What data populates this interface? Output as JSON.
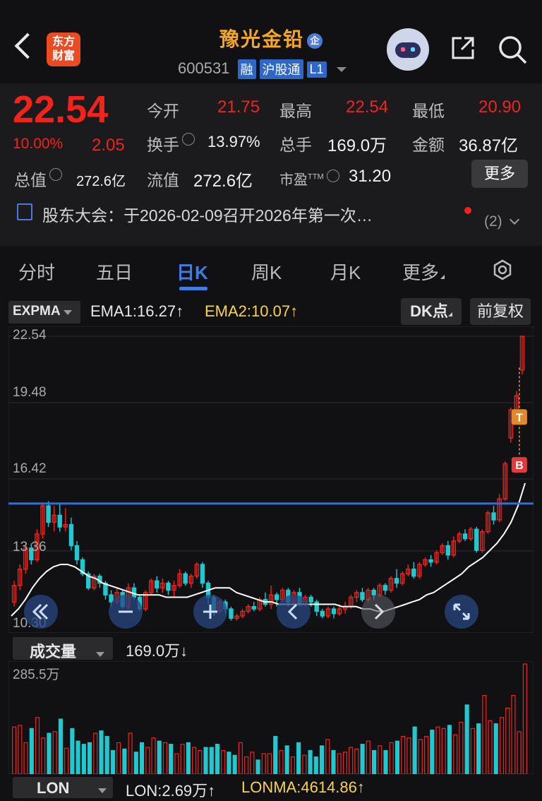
{
  "header": {
    "back_icon": "chevron-left-icon",
    "logo_text_1": "东方",
    "logo_text_2": "财富",
    "stock_name": "豫光金铅",
    "enterprise_badge": "企",
    "stock_code": "600531",
    "tags": [
      "融",
      "沪股通",
      "L1"
    ],
    "share_icon": "share-icon",
    "search_icon": "search-icon",
    "assistant_icon": "robot-icon"
  },
  "quote": {
    "price": "22.54",
    "change_pct": "10.00%",
    "change": "2.05",
    "open_label": "今开",
    "open": "21.75",
    "high_label": "最高",
    "high": "22.54",
    "low_label": "最低",
    "low": "20.90",
    "turnover_label": "换手",
    "turnover": "13.97%",
    "volume_label": "总手",
    "volume": "169.0万",
    "amount_label": "金额",
    "amount": "36.87亿",
    "mktcap_label": "总值",
    "mktcap": "272.6亿",
    "float_label": "流值",
    "float_cap": "272.6亿",
    "pe_label": "市盈",
    "pe_sup": "TTM",
    "pe": "31.20",
    "more_label": "更多"
  },
  "notice": {
    "text": "股东大会：于2026-02-09召开2026年第一次…",
    "count": "(2)"
  },
  "tabs": {
    "items": [
      "分时",
      "五日",
      "日K",
      "周K",
      "月K",
      "更多"
    ],
    "active": "日K"
  },
  "indicator": {
    "name": "EXPMA",
    "ema1": "EMA1:16.27",
    "ema2": "EMA2:10.07",
    "arrow": "↑",
    "dk_label": "DK点",
    "adjust_label": "前复权"
  },
  "chart_data": {
    "type": "candlestick",
    "y_ticks": [
      "22.54",
      "19.48",
      "16.42",
      "13.36",
      "10.30"
    ],
    "ylim": [
      10.3,
      22.54
    ],
    "reference_line": 15.4,
    "markers": [
      "T",
      "B"
    ],
    "candles": [
      [
        11.2,
        11.9,
        11.0,
        12.1
      ],
      [
        11.9,
        12.6,
        11.7,
        12.8
      ],
      [
        12.6,
        13.5,
        12.4,
        13.6
      ],
      [
        13.5,
        13.0,
        12.8,
        13.7
      ],
      [
        13.0,
        14.1,
        12.9,
        14.3
      ],
      [
        14.1,
        15.3,
        13.9,
        15.4
      ],
      [
        15.3,
        14.6,
        14.4,
        15.5
      ],
      [
        14.6,
        14.9,
        14.2,
        15.3
      ],
      [
        14.9,
        14.4,
        14.2,
        15.4
      ],
      [
        14.4,
        14.5,
        14.2,
        15.2
      ],
      [
        14.5,
        13.6,
        13.4,
        14.8
      ],
      [
        13.6,
        13.0,
        12.8,
        13.8
      ],
      [
        13.0,
        12.4,
        12.3,
        13.1
      ],
      [
        12.4,
        11.8,
        11.7,
        12.5
      ],
      [
        11.8,
        12.3,
        11.7,
        12.4
      ],
      [
        12.3,
        12.0,
        11.8,
        12.4
      ],
      [
        12.0,
        11.5,
        11.3,
        12.1
      ],
      [
        11.5,
        11.2,
        11.0,
        11.7
      ],
      [
        11.2,
        11.6,
        11.1,
        11.8
      ],
      [
        11.6,
        11.0,
        10.9,
        11.7
      ],
      [
        11.0,
        11.8,
        10.9,
        12.0
      ],
      [
        11.8,
        11.4,
        11.3,
        12.0
      ],
      [
        11.4,
        10.9,
        10.8,
        11.5
      ],
      [
        10.9,
        11.6,
        10.8,
        11.7
      ],
      [
        11.6,
        12.1,
        11.5,
        12.2
      ],
      [
        12.1,
        11.8,
        11.6,
        12.3
      ],
      [
        11.8,
        12.0,
        11.6,
        12.2
      ],
      [
        12.0,
        11.7,
        11.5,
        12.1
      ],
      [
        11.7,
        11.9,
        11.4,
        12.1
      ],
      [
        11.9,
        12.4,
        11.8,
        12.6
      ],
      [
        12.4,
        12.0,
        11.9,
        12.5
      ],
      [
        12.0,
        12.3,
        11.8,
        12.4
      ],
      [
        12.3,
        12.8,
        12.2,
        12.9
      ],
      [
        12.8,
        12.0,
        11.8,
        12.9
      ],
      [
        12.0,
        11.4,
        11.1,
        12.1
      ],
      [
        11.4,
        10.8,
        10.6,
        11.5
      ],
      [
        10.8,
        11.2,
        10.7,
        11.3
      ],
      [
        11.2,
        10.9,
        10.7,
        11.3
      ],
      [
        10.9,
        10.5,
        10.4,
        11.0
      ],
      [
        10.5,
        10.6,
        10.4,
        10.7
      ],
      [
        10.6,
        10.8,
        10.5,
        10.9
      ],
      [
        10.8,
        11.0,
        10.7,
        11.1
      ],
      [
        11.0,
        10.9,
        10.8,
        11.2
      ],
      [
        10.9,
        11.3,
        10.8,
        11.4
      ],
      [
        11.3,
        11.1,
        11.0,
        11.6
      ],
      [
        11.1,
        11.5,
        10.9,
        11.9
      ],
      [
        11.5,
        11.3,
        11.0,
        11.6
      ],
      [
        11.3,
        11.7,
        11.2,
        11.8
      ],
      [
        11.7,
        11.2,
        11.0,
        11.8
      ],
      [
        11.2,
        11.6,
        11.1,
        11.7
      ],
      [
        11.6,
        11.1,
        11.0,
        11.8
      ],
      [
        11.1,
        11.4,
        11.0,
        11.5
      ],
      [
        11.4,
        11.2,
        11.0,
        11.5
      ],
      [
        11.2,
        10.8,
        10.6,
        11.3
      ],
      [
        10.8,
        10.6,
        10.5,
        10.9
      ],
      [
        10.6,
        10.9,
        10.5,
        11.0
      ],
      [
        10.9,
        10.7,
        10.5,
        11.0
      ],
      [
        10.7,
        10.9,
        10.6,
        11.1
      ],
      [
        10.9,
        11.0,
        10.7,
        11.2
      ],
      [
        11.0,
        11.4,
        10.9,
        11.5
      ],
      [
        11.4,
        11.6,
        11.2,
        11.7
      ],
      [
        11.6,
        11.3,
        11.2,
        11.8
      ],
      [
        11.3,
        11.7,
        11.2,
        11.8
      ],
      [
        11.7,
        11.5,
        11.3,
        11.8
      ],
      [
        11.5,
        11.9,
        11.4,
        12.0
      ],
      [
        11.9,
        11.7,
        11.5,
        12.0
      ],
      [
        11.7,
        12.2,
        11.6,
        12.3
      ],
      [
        12.2,
        12.0,
        11.8,
        12.6
      ],
      [
        12.0,
        12.4,
        11.9,
        12.5
      ],
      [
        12.4,
        12.6,
        12.3,
        12.8
      ],
      [
        12.6,
        12.3,
        12.2,
        12.9
      ],
      [
        12.3,
        12.8,
        12.2,
        12.9
      ],
      [
        12.8,
        13.0,
        12.7,
        13.1
      ],
      [
        13.0,
        12.9,
        12.7,
        13.2
      ],
      [
        12.9,
        13.3,
        12.8,
        13.4
      ],
      [
        13.3,
        13.6,
        13.2,
        13.7
      ],
      [
        13.6,
        13.2,
        13.0,
        13.8
      ],
      [
        13.2,
        13.8,
        13.1,
        14.0
      ],
      [
        13.8,
        14.1,
        13.7,
        14.2
      ],
      [
        14.1,
        13.9,
        13.8,
        14.3
      ],
      [
        13.9,
        14.3,
        13.8,
        14.4
      ],
      [
        14.3,
        13.4,
        13.3,
        14.4
      ],
      [
        13.4,
        14.2,
        13.3,
        14.3
      ],
      [
        14.2,
        15.0,
        14.1,
        15.1
      ],
      [
        15.0,
        14.7,
        14.5,
        15.3
      ],
      [
        14.7,
        15.6,
        14.6,
        15.8
      ],
      [
        15.6,
        17.1,
        15.5,
        17.2
      ],
      [
        18.2,
        19.4,
        18.0,
        19.5
      ],
      [
        19.4,
        20.0,
        19.2,
        20.2
      ],
      [
        21.1,
        22.54,
        20.9,
        22.54
      ]
    ],
    "ema_line": [
      10.6,
      10.9,
      11.3,
      11.8,
      12.2,
      12.5,
      12.7,
      12.8,
      12.8,
      12.7,
      12.5,
      12.3,
      12.2,
      12.0,
      11.9,
      11.8,
      11.7,
      11.6,
      11.5,
      11.5,
      11.5,
      11.5,
      11.4,
      11.4,
      11.4,
      11.4,
      11.5,
      11.6,
      11.7,
      11.8,
      11.8,
      11.8,
      11.6,
      11.5,
      11.4,
      11.3,
      11.2,
      11.2,
      11.1,
      11.1,
      11.1,
      11.1,
      11.1,
      11.1,
      11.1,
      11.1,
      11.1,
      11.0,
      11.0,
      11.0,
      10.9,
      10.9,
      10.8,
      10.8,
      10.9,
      11.0,
      11.1,
      11.2,
      11.3,
      11.5,
      11.6,
      11.8,
      12.0,
      12.2,
      12.4,
      12.7,
      12.9,
      13.1,
      13.4,
      13.7,
      14.1,
      14.6,
      15.3,
      16.27
    ]
  },
  "volume": {
    "label": "成交量",
    "value": "169.0万",
    "arrow": "↓",
    "max_label": "285.5万",
    "lon_label": "LON",
    "lon_value": "LON:2.69万",
    "lonma_value": "LONMA:4614.86",
    "values": [
      60,
      62,
      40,
      58,
      72,
      46,
      52,
      54,
      70,
      33,
      58,
      42,
      38,
      40,
      52,
      55,
      48,
      30,
      40,
      32,
      52,
      28,
      40,
      34,
      46,
      42,
      40,
      38,
      26,
      38,
      40,
      34,
      30,
      34,
      34,
      38,
      30,
      28,
      24,
      40,
      22,
      28,
      18,
      26,
      26,
      48,
      30,
      36,
      22,
      40,
      24,
      30,
      22,
      36,
      44,
      30,
      26,
      28,
      34,
      32,
      38,
      42,
      30,
      36,
      30,
      40,
      42,
      48,
      46,
      60,
      44,
      48,
      56,
      60,
      58,
      62,
      50,
      66,
      88,
      58,
      64,
      100,
      68,
      64,
      72,
      84,
      100,
      54,
      140
    ]
  },
  "colors": {
    "up": "#f2231b",
    "down": "#20c8d0",
    "ema": "#ffffff",
    "reference": "#2a6fe8",
    "accent_title": "#f5a623"
  }
}
